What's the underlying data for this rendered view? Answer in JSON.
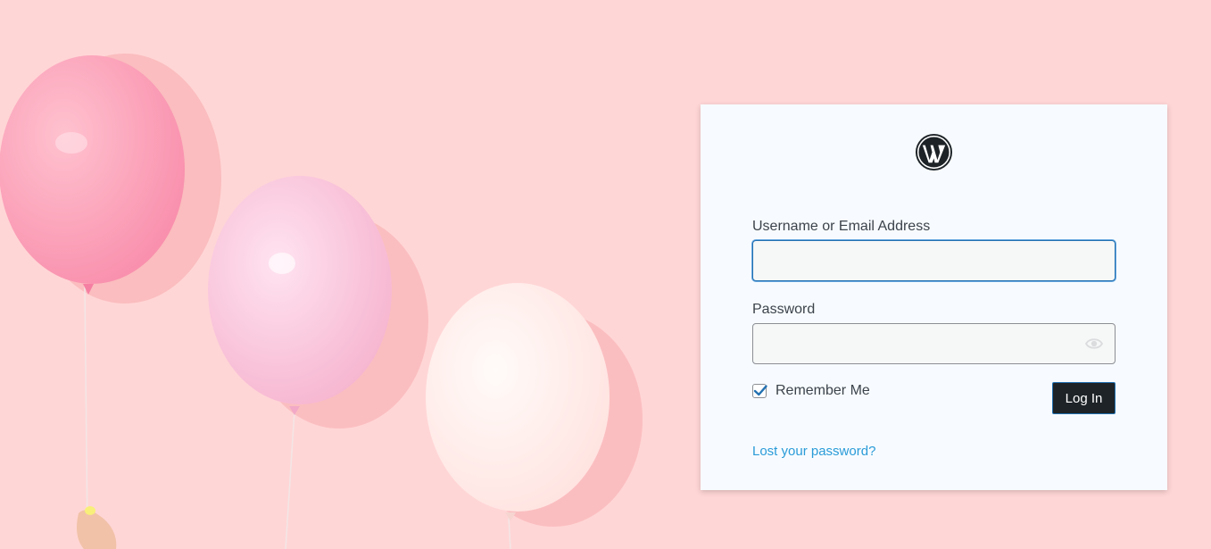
{
  "login": {
    "username_label": "Username or Email Address",
    "username_value": "",
    "password_label": "Password",
    "password_value": "",
    "remember_label": "Remember Me",
    "remember_checked": true,
    "login_button": "Log In",
    "lost_password": "Lost your password?"
  },
  "colors": {
    "background": "#ffd6d6",
    "card": "#f7fbff",
    "button": "#1d2327",
    "link": "#2a9bd8",
    "focus": "#2271b1"
  },
  "icons": {
    "logo": "wordpress-logo-icon",
    "eye": "eye-icon",
    "check": "check-icon"
  }
}
